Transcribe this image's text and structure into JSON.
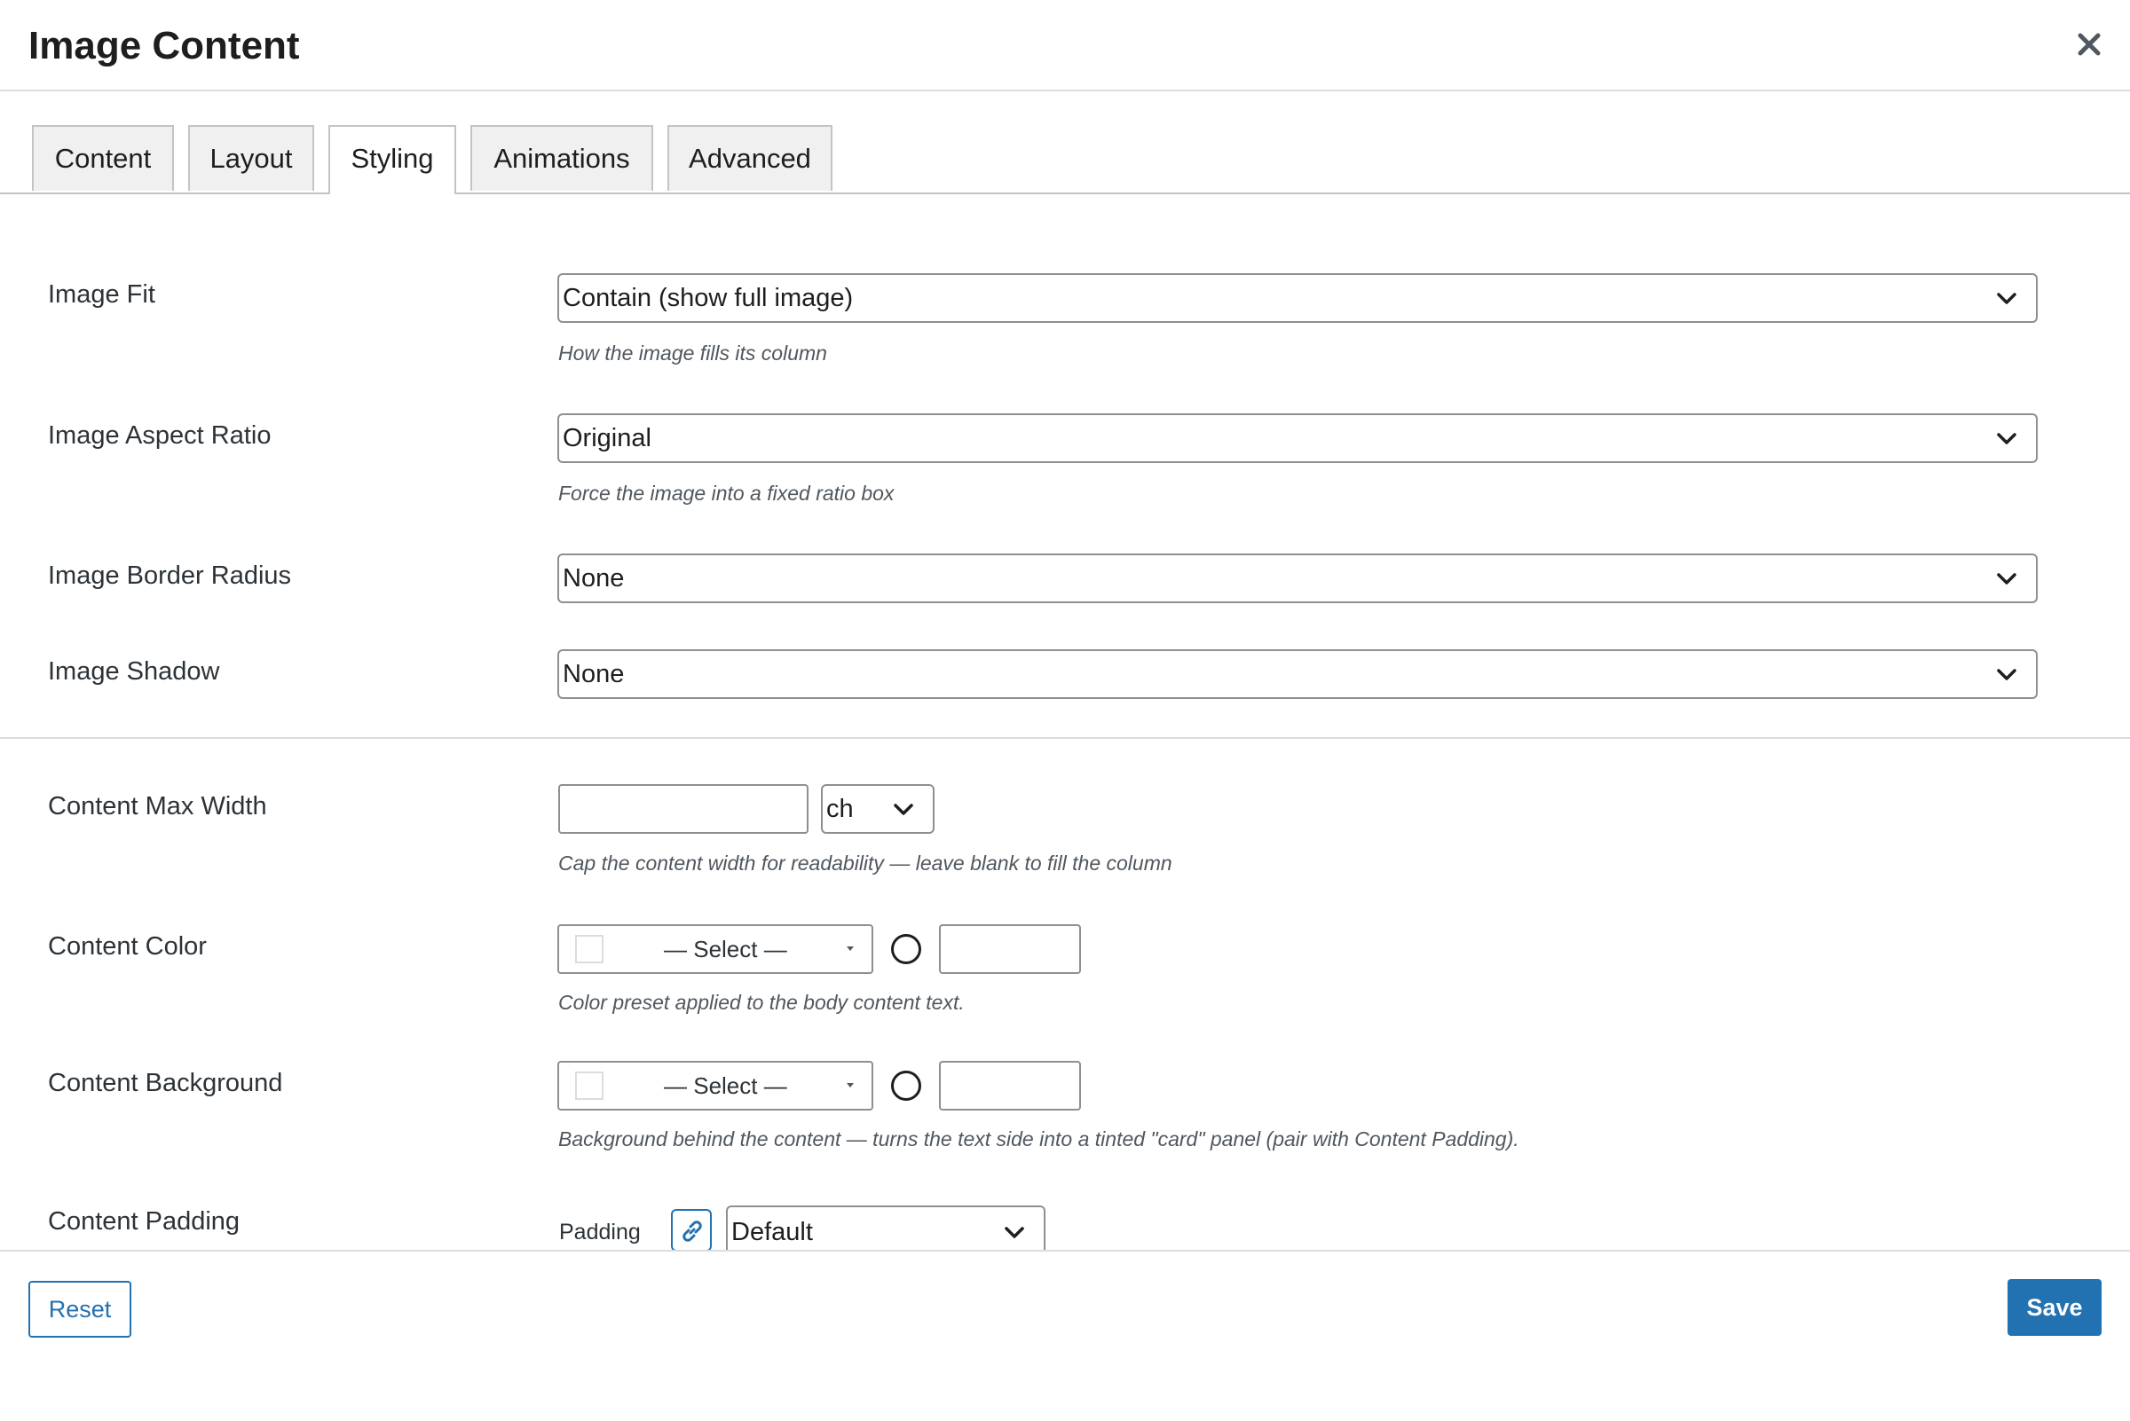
{
  "modal": {
    "title": "Image Content"
  },
  "tabs": [
    {
      "label": "Content",
      "active": false
    },
    {
      "label": "Layout",
      "active": false
    },
    {
      "label": "Styling",
      "active": true
    },
    {
      "label": "Animations",
      "active": false
    },
    {
      "label": "Advanced",
      "active": false
    }
  ],
  "fields": {
    "image_fit": {
      "label": "Image Fit",
      "value": "Contain (show full image)",
      "help": "How the image fills its column"
    },
    "image_aspect_ratio": {
      "label": "Image Aspect Ratio",
      "value": "Original",
      "help": "Force the image into a fixed ratio box"
    },
    "image_border_radius": {
      "label": "Image Border Radius",
      "value": "None"
    },
    "image_shadow": {
      "label": "Image Shadow",
      "value": "None"
    },
    "content_max_width": {
      "label": "Content Max Width",
      "value": "",
      "unit": "ch",
      "help": "Cap the content width for readability — leave blank to fill the column"
    },
    "content_color": {
      "label": "Content Color",
      "value": "— Select —",
      "custom_value": "",
      "help": "Color preset applied to the body content text."
    },
    "content_background": {
      "label": "Content Background",
      "value": "— Select —",
      "custom_value": "",
      "help": "Background behind the content — turns the text side into a tinted \"card\" panel (pair with Content Padding)."
    },
    "content_padding": {
      "label": "Content Padding",
      "sub_label": "Padding",
      "value": "Default"
    }
  },
  "footer": {
    "reset_label": "Reset",
    "save_label": "Save"
  },
  "icons": {
    "close": "close-icon",
    "chevron": "chevron-down-icon",
    "link": "link-icon",
    "dropdown_arrow": "caret-down-icon"
  },
  "colors": {
    "accent": "#2271b1",
    "border": "#8c8f94",
    "tab_bg": "#f0f0f1"
  }
}
